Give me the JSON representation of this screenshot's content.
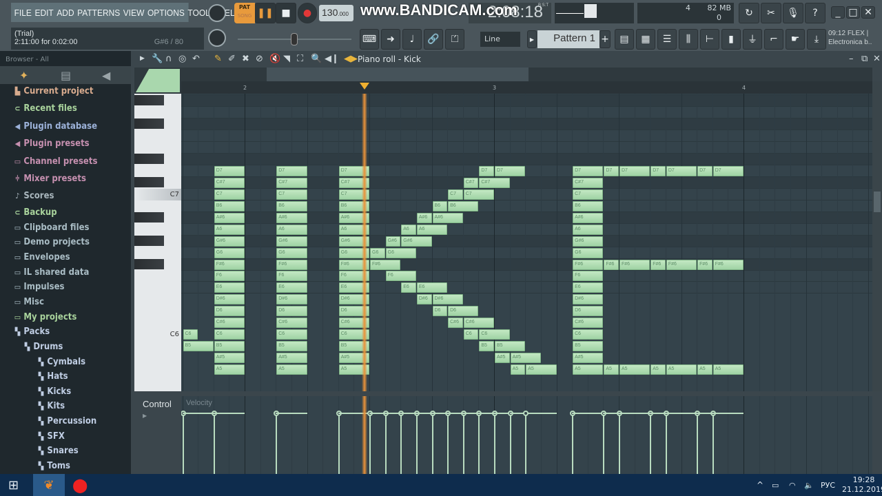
{
  "menu": [
    "FILE",
    "EDIT",
    "ADD",
    "PATTERNS",
    "VIEW",
    "OPTIONS",
    "TOOLS",
    "HELP"
  ],
  "hint": {
    "line1": "(Trial)",
    "line2": "2:11:00 for 0:02:00",
    "note_info": "G#6 / 80"
  },
  "transport": {
    "pat_label": "PAT",
    "song_label": "SONG",
    "tempo": "130",
    "tempo_decimal": ".000",
    "time": "2:08:18",
    "time_format": "B:S:T"
  },
  "watermark": "www.BANDICAM.com",
  "monitor": {
    "cpu_value": "4",
    "memory": "82 MB",
    "polyphony": "0"
  },
  "snap": "Line",
  "pattern": "Pattern 1",
  "news": {
    "time": "09:12",
    "title": "FLEX |",
    "subtitle": "Electronica b.."
  },
  "browser": {
    "title": "Browser - All",
    "items": [
      {
        "label": "Current project",
        "icon": "project-icon",
        "color": "#d8ab8e",
        "indent": 0
      },
      {
        "label": "Recent files",
        "icon": "folder-recent-icon",
        "color": "#a9d39c",
        "indent": 0
      },
      {
        "label": "Plugin database",
        "icon": "plugin-icon",
        "color": "#9cb2d9",
        "indent": 0
      },
      {
        "label": "Plugin presets",
        "icon": "plugin-icon",
        "color": "#c690b0",
        "indent": 0
      },
      {
        "label": "Channel presets",
        "icon": "channel-icon",
        "color": "#c690b0",
        "indent": 0
      },
      {
        "label": "Mixer presets",
        "icon": "mixer-icon",
        "color": "#c690b0",
        "indent": 0
      },
      {
        "label": "Scores",
        "icon": "note-icon",
        "color": "#a9b6bd",
        "indent": 0
      },
      {
        "label": "Backup",
        "icon": "folder-recent-icon",
        "color": "#a9d39c",
        "indent": 0
      },
      {
        "label": "Clipboard files",
        "icon": "folder-icon",
        "color": "#a9bcc4",
        "indent": 0
      },
      {
        "label": "Demo projects",
        "icon": "folder-icon",
        "color": "#a9bcc4",
        "indent": 0
      },
      {
        "label": "Envelopes",
        "icon": "folder-icon",
        "color": "#a9bcc4",
        "indent": 0
      },
      {
        "label": "IL shared data",
        "icon": "folder-icon",
        "color": "#a9bcc4",
        "indent": 0
      },
      {
        "label": "Impulses",
        "icon": "folder-icon",
        "color": "#a9bcc4",
        "indent": 0
      },
      {
        "label": "Misc",
        "icon": "folder-icon",
        "color": "#a9bcc4",
        "indent": 0
      },
      {
        "label": "My projects",
        "icon": "folder-icon",
        "color": "#a9d39c",
        "indent": 0
      },
      {
        "label": "Packs",
        "icon": "pack-icon",
        "color": "#bfcde3",
        "indent": 0
      },
      {
        "label": "Drums",
        "icon": "pack-icon",
        "color": "#bfcde3",
        "indent": 1
      },
      {
        "label": "Cymbals",
        "icon": "pack-icon",
        "color": "#bfcde3",
        "indent": 2
      },
      {
        "label": "Hats",
        "icon": "pack-icon",
        "color": "#bfcde3",
        "indent": 2
      },
      {
        "label": "Kicks",
        "icon": "pack-icon",
        "color": "#bfcde3",
        "indent": 2
      },
      {
        "label": "Kits",
        "icon": "pack-icon",
        "color": "#bfcde3",
        "indent": 2
      },
      {
        "label": "Percussion",
        "icon": "pack-icon",
        "color": "#bfcde3",
        "indent": 2
      },
      {
        "label": "SFX",
        "icon": "pack-icon",
        "color": "#bfcde3",
        "indent": 2
      },
      {
        "label": "Snares",
        "icon": "pack-icon",
        "color": "#bfcde3",
        "indent": 2
      },
      {
        "label": "Toms",
        "icon": "pack-icon",
        "color": "#bfcde3",
        "indent": 2
      }
    ]
  },
  "piano_roll": {
    "title": "Piano roll - Kick",
    "bar_labels": [
      "2",
      "3",
      "4"
    ],
    "key_labels": [
      "C7",
      "C6"
    ],
    "control_label": "Control",
    "control_target": "Velocity",
    "playhead_step": 23.7,
    "note_color": "#b4e0b6",
    "playhead_color": "#e8923a",
    "note_columns": [
      {
        "start": 14,
        "len": 2
      },
      {
        "start": 18,
        "len": 2
      },
      {
        "start": 22,
        "len": 2
      },
      {
        "start": 37,
        "len": 2
      }
    ],
    "column_pitches": [
      "D7",
      "C#7",
      "C7",
      "B6",
      "A#6",
      "A6",
      "G#6",
      "G6",
      "F#6",
      "F6",
      "E6",
      "D#6",
      "D6",
      "C#6",
      "C6",
      "B5",
      "A#5",
      "A5"
    ],
    "notes": [
      [
        "C6",
        12,
        1
      ],
      [
        "B5",
        12,
        2
      ],
      [
        "D7",
        31,
        1
      ],
      [
        "D7",
        32,
        2
      ],
      [
        "C#7",
        30,
        1
      ],
      [
        "C#7",
        31,
        2
      ],
      [
        "C7",
        29,
        1
      ],
      [
        "C7",
        30,
        2
      ],
      [
        "B6",
        28,
        1
      ],
      [
        "B6",
        29,
        2
      ],
      [
        "A#6",
        27,
        1
      ],
      [
        "A#6",
        28,
        2
      ],
      [
        "A6",
        26,
        1
      ],
      [
        "A6",
        27,
        2
      ],
      [
        "G#6",
        25,
        1
      ],
      [
        "G#6",
        26,
        2
      ],
      [
        "G6",
        24,
        1
      ],
      [
        "G6",
        25,
        2
      ],
      [
        "F#6",
        24,
        2
      ],
      [
        "F6",
        25,
        2
      ],
      [
        "E6",
        26,
        1
      ],
      [
        "E6",
        27,
        2
      ],
      [
        "D#6",
        27,
        1
      ],
      [
        "D#6",
        28,
        2
      ],
      [
        "D6",
        28,
        1
      ],
      [
        "D6",
        29,
        2
      ],
      [
        "C#6",
        29,
        1
      ],
      [
        "C#6",
        30,
        2
      ],
      [
        "C6",
        30,
        1
      ],
      [
        "C6",
        31,
        2
      ],
      [
        "B5",
        31,
        1
      ],
      [
        "B5",
        32,
        2
      ],
      [
        "A#5",
        32,
        1
      ],
      [
        "A#5",
        33,
        2
      ],
      [
        "A5",
        33,
        1
      ],
      [
        "A5",
        34,
        2
      ],
      [
        "D7",
        39,
        1
      ],
      [
        "D7",
        40,
        2
      ],
      [
        "D7",
        42,
        1
      ],
      [
        "D7",
        43,
        2
      ],
      [
        "D7",
        45,
        1
      ],
      [
        "D7",
        46,
        2
      ],
      [
        "F#6",
        39,
        1
      ],
      [
        "F#6",
        40,
        2
      ],
      [
        "F#6",
        42,
        1
      ],
      [
        "F#6",
        43,
        2
      ],
      [
        "F#6",
        45,
        1
      ],
      [
        "F#6",
        46,
        2
      ],
      [
        "A5",
        39,
        1
      ],
      [
        "A5",
        40,
        2
      ],
      [
        "A5",
        42,
        1
      ],
      [
        "A5",
        43,
        2
      ],
      [
        "A5",
        45,
        1
      ],
      [
        "A5",
        46,
        2
      ]
    ]
  },
  "taskbar": {
    "language": "РУС",
    "time": "19:28",
    "date": "21.12.2019"
  }
}
